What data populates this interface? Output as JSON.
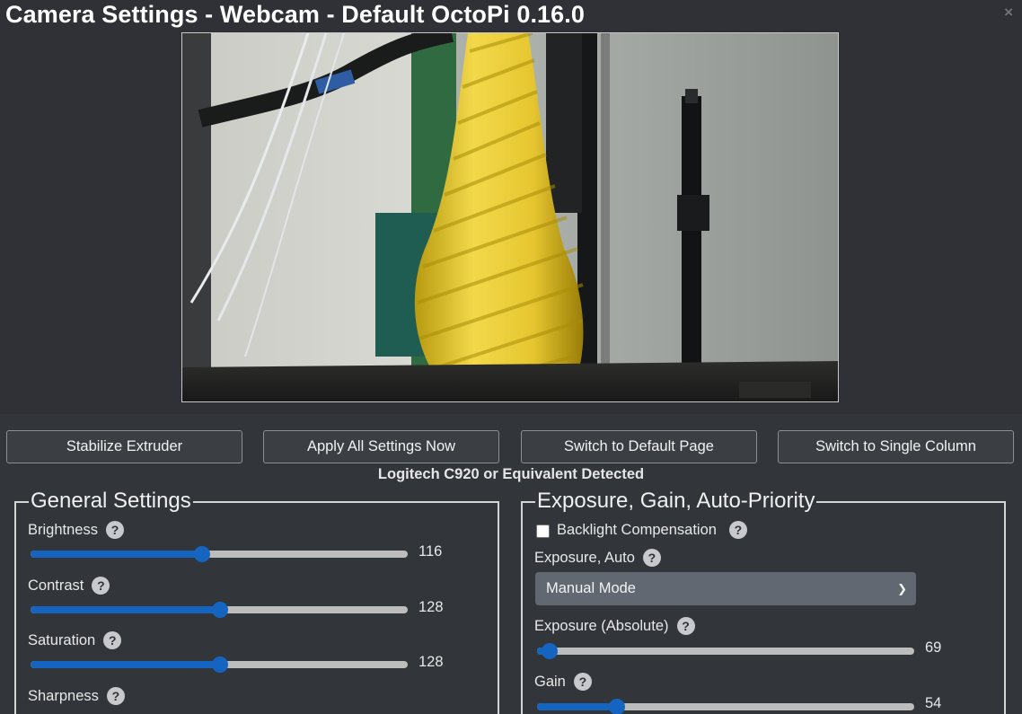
{
  "window": {
    "title": "Camera Settings - Webcam - Default OctoPi 0.16.0",
    "close_icon": "×"
  },
  "buttons": {
    "stabilize": "Stabilize Extruder",
    "apply": "Apply All Settings Now",
    "default_page": "Switch to Default Page",
    "single_column": "Switch to Single Column"
  },
  "detected_text": "Logitech C920 or Equivalent Detected",
  "general": {
    "legend": "General Settings",
    "brightness": {
      "label": "Brightness",
      "value": "116",
      "level": 0.455
    },
    "contrast": {
      "label": "Contrast",
      "value": "128",
      "level": 0.502
    },
    "saturation": {
      "label": "Saturation",
      "value": "128",
      "level": 0.502
    },
    "sharpness": {
      "label": "Sharpness"
    }
  },
  "exposure": {
    "legend": "Exposure, Gain, Auto-Priority",
    "backlight": {
      "label": "Backlight Compensation",
      "checked": false
    },
    "exposure_auto": {
      "label": "Exposure, Auto",
      "selected": "Manual Mode"
    },
    "exposure_abs": {
      "label": "Exposure (Absolute)",
      "value": "69",
      "level": 0.034
    },
    "gain": {
      "label": "Gain",
      "value": "54",
      "level": 0.212
    }
  },
  "help_glyph": "?",
  "colors": {
    "accent": "#1565c0",
    "background": "#2f3136",
    "filament": "#e8cc36"
  }
}
